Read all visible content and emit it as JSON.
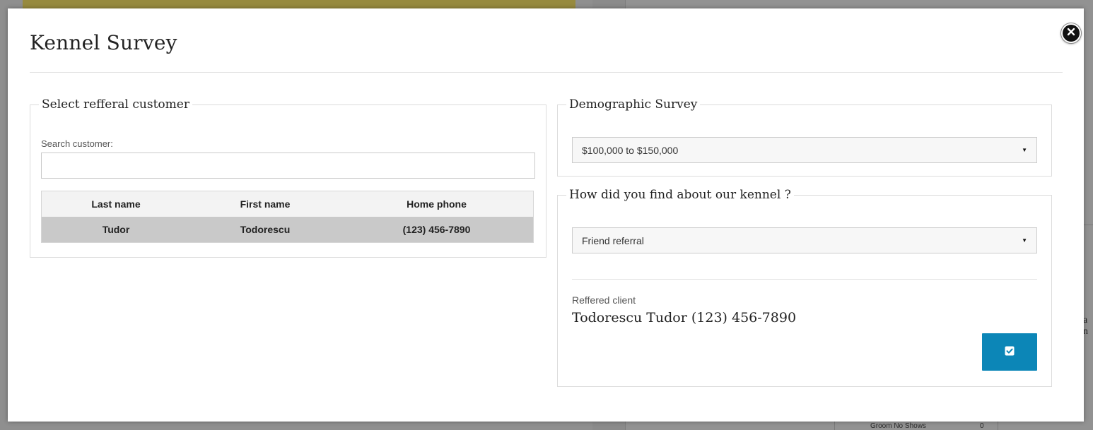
{
  "background": {
    "groom_label": "Groom No Shows",
    "groom_count": "0"
  },
  "modal": {
    "title": "Kennel Survey",
    "close_icon": "close-icon"
  },
  "referral_section": {
    "legend": "Select refferal customer",
    "search_label": "Search customer:",
    "search_value": "",
    "search_placeholder": "",
    "columns": [
      "Last name",
      "First name",
      "Home phone"
    ],
    "rows": [
      [
        "Tudor",
        "Todorescu",
        "(123) 456-7890"
      ]
    ]
  },
  "demographic_section": {
    "legend": "Demographic Survey",
    "selected": "$100,000 to $150,000"
  },
  "find_section": {
    "legend": "How did you find about our kennel ?",
    "selected": "Friend referral",
    "referred_label": "Reffered client",
    "referred_value": "Todorescu Tudor (123) 456-7890",
    "confirm_icon": "checkbox-check-icon"
  },
  "colors": {
    "accent": "#0c86b7",
    "selected_row": "#c9c9c9",
    "overlay": "#8a8a8a"
  }
}
